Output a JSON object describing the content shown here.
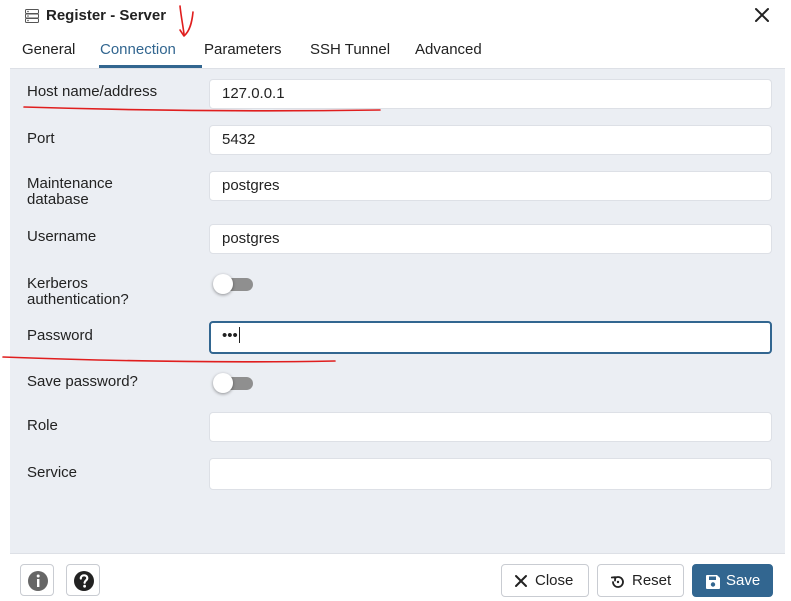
{
  "window": {
    "title": "Register - Server"
  },
  "tabs": [
    {
      "label": "General"
    },
    {
      "label": "Connection"
    },
    {
      "label": "Parameters"
    },
    {
      "label": "SSH Tunnel"
    },
    {
      "label": "Advanced"
    }
  ],
  "form": {
    "host": {
      "label": "Host name/address",
      "value": "127.0.0.1"
    },
    "port": {
      "label": "Port",
      "value": "5432"
    },
    "maintenance_db": {
      "label_line1": "Maintenance",
      "label_line2": "database",
      "value": "postgres"
    },
    "username": {
      "label": "Username",
      "value": "postgres"
    },
    "kerberos": {
      "label_line1": "Kerberos",
      "label_line2": "authentication?",
      "enabled": false
    },
    "password": {
      "label": "Password",
      "value": "•••"
    },
    "save_password": {
      "label": "Save password?",
      "enabled": false
    },
    "role": {
      "label": "Role",
      "value": ""
    },
    "service": {
      "label": "Service",
      "value": ""
    }
  },
  "footer": {
    "close_label": "Close",
    "reset_label": "Reset",
    "save_label": "Save"
  },
  "colors": {
    "accent": "#326690",
    "annotation": "#e01e1e",
    "content_bg": "#ebeef3"
  },
  "icons": [
    "server-icon",
    "close-icon",
    "info-icon",
    "help-icon",
    "x-icon",
    "reset-icon",
    "save-icon"
  ]
}
